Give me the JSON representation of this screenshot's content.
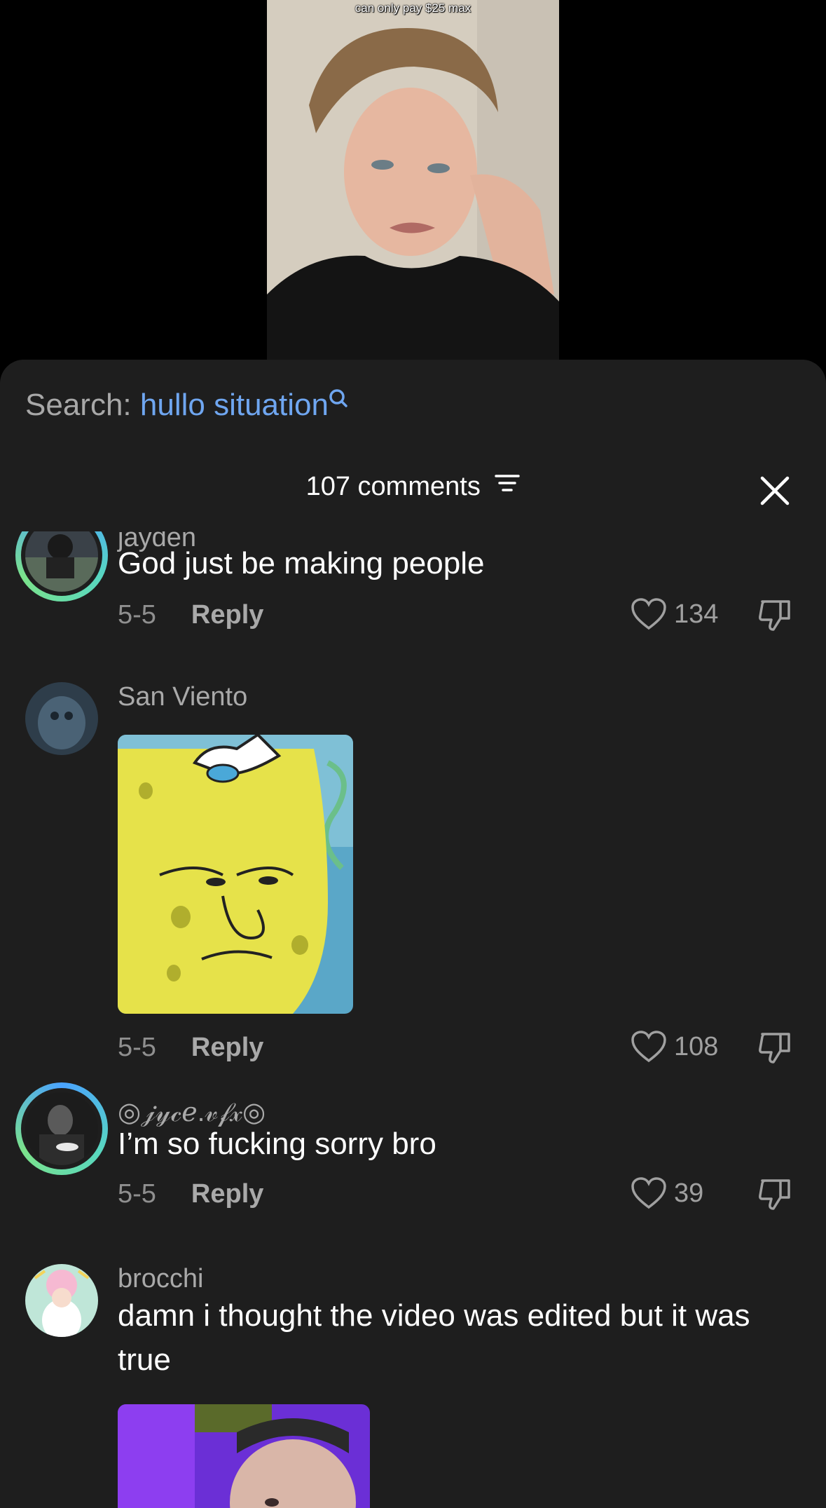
{
  "video": {
    "caption": "can only pay $25 max"
  },
  "search": {
    "label": "Search:",
    "term": "hullo situation"
  },
  "header": {
    "comments_count": "107 comments"
  },
  "comments": [
    {
      "username": "jayden",
      "text": "God just be making people",
      "date": "5-5",
      "reply": "Reply",
      "likes": "134"
    },
    {
      "username": "San Viento",
      "text": "",
      "date": "5-5",
      "reply": "Reply",
      "likes": "108"
    },
    {
      "username": "◎𝒿𝓎𝒸ℯ.𝓋𝒻𝓍◎",
      "text": "I’m so fucking sorry bro",
      "date": "5-5",
      "reply": "Reply",
      "likes": "39"
    },
    {
      "username": "brocchi",
      "text": "damn i thought the video was edited but it was true"
    }
  ],
  "colors": {
    "accent": "#6fa6f0",
    "sheet_bg": "#1e1e1e",
    "ring": "#58d7c0"
  }
}
